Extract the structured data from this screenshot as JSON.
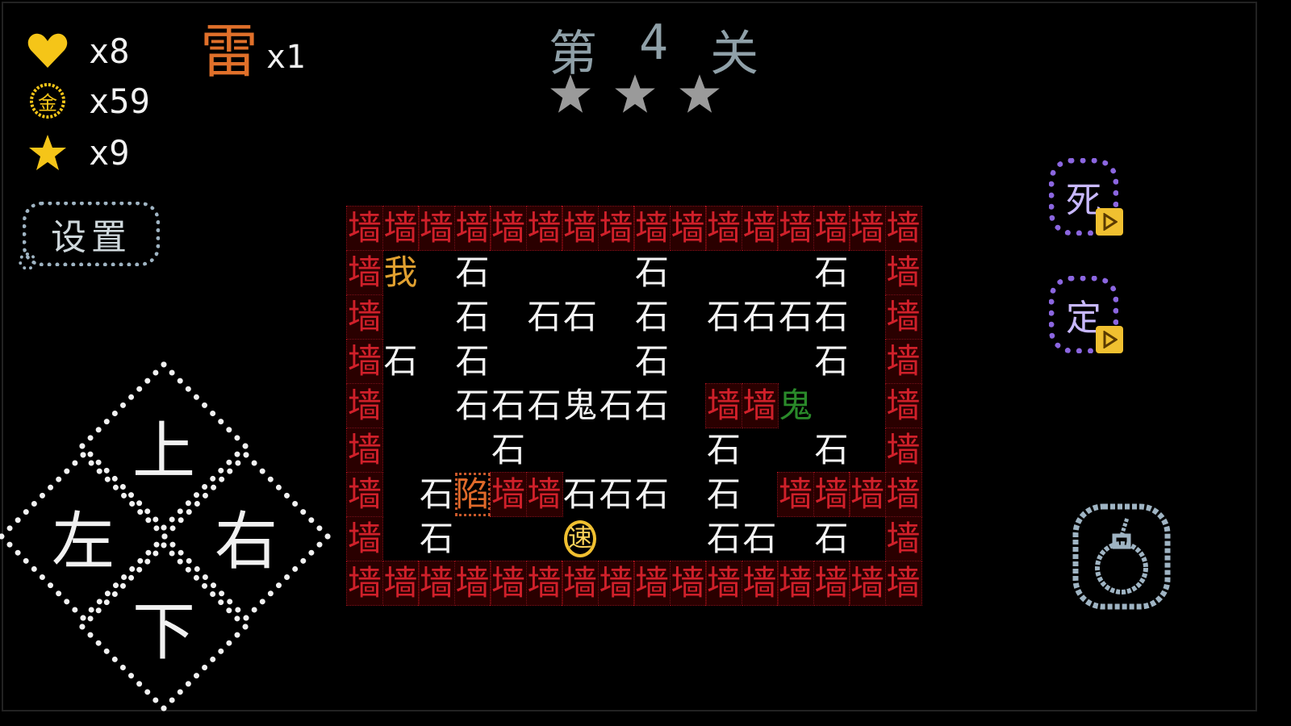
{
  "hud": {
    "lives": "x8",
    "coins": "x59",
    "stars": "x9",
    "coin_glyph": "金",
    "thunder_glyph": "雷",
    "thunder_count": "x1",
    "settings_label": "设置"
  },
  "level": {
    "prefix": "第",
    "number": "4",
    "suffix": "关",
    "stars_earned": 0,
    "stars_total": 3
  },
  "board": {
    "cols": 16,
    "rows": 9,
    "wall_glyph": "墙",
    "rock_glyph": "石",
    "player_glyph": "我",
    "ghost_glyph": "鬼",
    "trap_glyph": "陷",
    "speed_glyph": "速",
    "layout": [
      "WWWWWWWWWWWWWWWW",
      "WP.R....R....R.W",
      "W..R.RR.R.RRRR.W",
      "WR.R....R....R.W",
      "W..RRRGRR.WWg..W",
      "W...R.....R..R.W",
      "W.RTWWRRR.R.WWWW",
      "W.R...S...RR.R.W",
      "WWWWWWWWWWWWWWWW"
    ]
  },
  "dpad": {
    "up": "上",
    "down": "下",
    "left": "左",
    "right": "右"
  },
  "skills": {
    "death": "死",
    "freeze": "定"
  },
  "colors": {
    "wall": "#d0202a",
    "rock": "#f3f3f3",
    "player": "#e0a030",
    "ghost_green": "#2a8a2a",
    "trap": "#e06a2a",
    "speed": "#f0c030",
    "skill_ring": "#8b66e0",
    "level_gray": "#8fa0a8",
    "hud_gold": "#f5c518"
  },
  "icons": {
    "lives": "heart-icon",
    "coins": "coin-icon",
    "stars": "star-icon",
    "bomb": "bomb-icon",
    "play": "play-icon"
  }
}
